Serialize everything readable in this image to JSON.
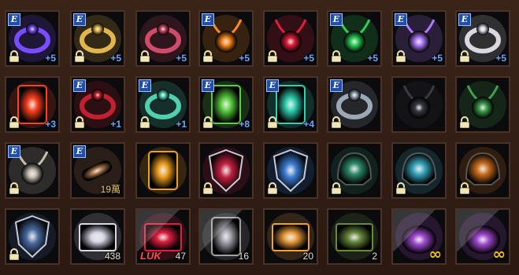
{
  "inventory": {
    "rows": [
      [
        {
          "icon": "bracelet-icon",
          "color": "#7a4cff",
          "equipped": true,
          "locked": true,
          "level": "+5"
        },
        {
          "icon": "gold-chain-bracelet-icon",
          "color": "#e2b64a",
          "equipped": true,
          "locked": true,
          "level": "+5"
        },
        {
          "icon": "ruby-chain-bracelet-icon",
          "color": "#d04a6a",
          "equipped": false,
          "locked": true,
          "level": "+5"
        },
        {
          "icon": "gold-orb-necklace-icon",
          "color": "#ff8a20",
          "equipped": true,
          "locked": true,
          "level": "+5"
        },
        {
          "icon": "ruby-necklace-icon",
          "color": "#e0203a",
          "equipped": false,
          "locked": true,
          "level": "+5"
        },
        {
          "icon": "emerald-necklace-icon",
          "color": "#2fcf5a",
          "equipped": true,
          "locked": true,
          "level": "+5"
        },
        {
          "icon": "starlight-necklace-icon",
          "color": "#b07aff",
          "equipped": true,
          "locked": true,
          "level": "+5"
        },
        {
          "icon": "silver-ring-icon",
          "color": "#d8d8e0",
          "equipped": true,
          "locked": true,
          "level": "+5"
        }
      ],
      [
        {
          "icon": "fire-rune-stone-icon",
          "color": "#ff4020",
          "equipped": false,
          "locked": true,
          "level": "+3"
        },
        {
          "icon": "ruby-ring-icon",
          "color": "#c02030",
          "equipped": true,
          "locked": true,
          "level": "+1"
        },
        {
          "icon": "jade-ring-icon",
          "color": "#4fd0b0",
          "equipped": true,
          "locked": true,
          "level": "+1"
        },
        {
          "icon": "green-rune-tablet-icon",
          "color": "#5ad040",
          "equipped": true,
          "locked": true,
          "level": "+8"
        },
        {
          "icon": "teal-rune-tablet-icon",
          "color": "#30d0b0",
          "equipped": true,
          "locked": true,
          "level": "+4"
        },
        {
          "icon": "steel-ring-icon",
          "color": "#9aa8b8",
          "equipped": true,
          "locked": true,
          "level": ""
        },
        {
          "icon": "dark-pendant-icon",
          "color": "#3a3a44",
          "equipped": false,
          "locked": false,
          "level": ""
        },
        {
          "icon": "emerald-pendant-icon",
          "color": "#40a050",
          "equipped": false,
          "locked": true,
          "level": ""
        }
      ],
      [
        {
          "icon": "skull-necklace-icon",
          "color": "#c8c0b0",
          "equipped": true,
          "locked": true,
          "qty": ""
        },
        {
          "icon": "bullet-icon",
          "color": "#b07a50",
          "equipped": true,
          "locked": false,
          "qty": "19萬"
        },
        {
          "icon": "gold-tome-icon",
          "color": "#f0a020",
          "equipped": false,
          "locked": false,
          "qty": ""
        },
        {
          "icon": "red-crest-shield-icon",
          "color": "#c02040",
          "equipped": false,
          "locked": true,
          "qty": ""
        },
        {
          "icon": "blue-arrow-shield-icon",
          "color": "#3a7ad0",
          "equipped": false,
          "locked": true,
          "qty": ""
        },
        {
          "icon": "green-spiked-helm-icon",
          "color": "#2f8a6a",
          "equipped": false,
          "locked": true,
          "qty": ""
        },
        {
          "icon": "teal-fin-helm-icon",
          "color": "#3aa8c0",
          "equipped": false,
          "locked": true,
          "qty": ""
        },
        {
          "icon": "horned-demon-helm-icon",
          "color": "#d07020",
          "equipped": false,
          "locked": true,
          "qty": ""
        }
      ],
      [
        {
          "icon": "spiked-blue-shield-icon",
          "color": "#4a6aa0",
          "equipped": false,
          "locked": true,
          "qty": ""
        },
        {
          "icon": "silver-chest-icon",
          "color": "#d8d8e8",
          "equipped": false,
          "locked": false,
          "qty": "438"
        },
        {
          "icon": "red-luck-cube-icon",
          "color": "#e02040",
          "equipped": false,
          "locked": false,
          "qty": "47",
          "tag": "LUK"
        },
        {
          "icon": "stone-hammer-icon",
          "color": "#a0a0a8",
          "equipped": false,
          "locked": false,
          "qty": "16"
        },
        {
          "icon": "glowing-chest-icon",
          "color": "#f0a040",
          "equipped": false,
          "locked": false,
          "qty": "20"
        },
        {
          "icon": "green-rune-chest-icon",
          "color": "#6a8a40",
          "equipped": false,
          "locked": false,
          "qty": "2"
        },
        {
          "icon": "purple-pot-icon",
          "color": "#a04ad0",
          "equipped": false,
          "locked": false,
          "qty": "∞"
        },
        {
          "icon": "purple-pot-icon",
          "color": "#a04ad0",
          "equipped": false,
          "locked": false,
          "qty": "∞"
        }
      ]
    ]
  }
}
